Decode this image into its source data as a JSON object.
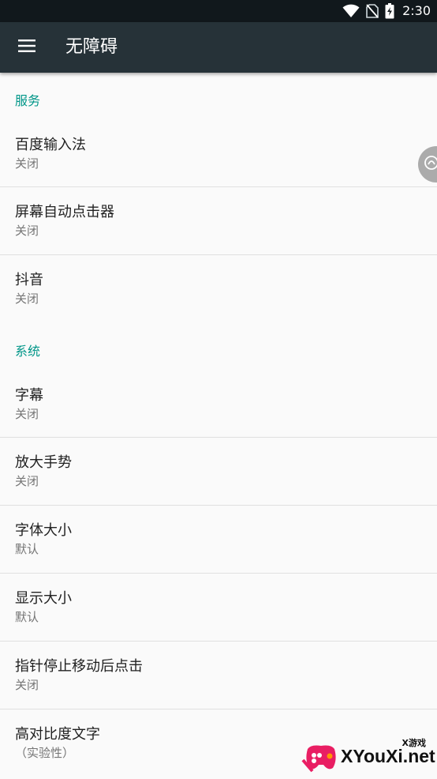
{
  "status_bar": {
    "time": "2:30",
    "icons": [
      "wifi-icon",
      "no-sim-icon",
      "battery-charging-icon"
    ]
  },
  "toolbar": {
    "menu_icon": "hamburger-menu-icon",
    "title": "无障碍"
  },
  "sections": [
    {
      "header": "服务",
      "items": [
        {
          "title": "百度输入法",
          "summary": "关闭"
        },
        {
          "title": "屏幕自动点击器",
          "summary": "关闭"
        },
        {
          "title": "抖音",
          "summary": "关闭"
        }
      ]
    },
    {
      "header": "系统",
      "items": [
        {
          "title": "字幕",
          "summary": "关闭"
        },
        {
          "title": "放大手势",
          "summary": "关闭"
        },
        {
          "title": "字体大小",
          "summary": "默认"
        },
        {
          "title": "显示大小",
          "summary": "默认"
        },
        {
          "title": "指针停止移动后点击",
          "summary": "关闭"
        },
        {
          "title": "高对比度文字",
          "summary": "（实验性）"
        }
      ]
    }
  ],
  "floating_ball": {
    "icon": "floating-assistant-icon"
  },
  "watermark": {
    "small_text": "X游戏",
    "main_text": "XYouXi.net",
    "colors": {
      "pink": "#e91e63",
      "orange": "#ff9800"
    }
  },
  "colors": {
    "status_bar": "#11181c",
    "toolbar": "#263238",
    "accent": "#009688",
    "background": "#fafafa",
    "title_text": "#212121",
    "summary_text": "#757575",
    "divider": "#e0e0e0"
  }
}
